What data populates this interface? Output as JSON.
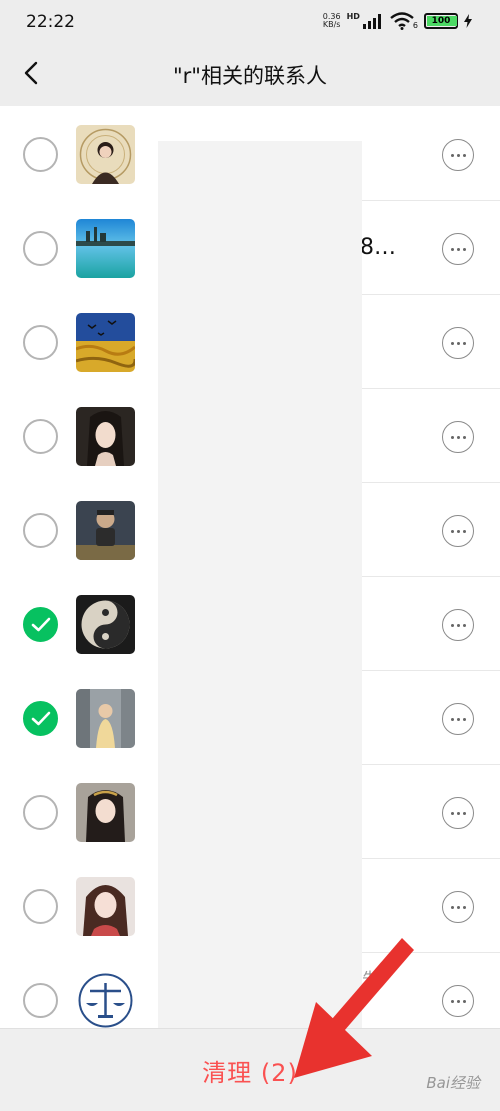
{
  "status_bar": {
    "time": "22:22",
    "net_speed_value": "0.36",
    "net_speed_unit": "KB/s",
    "hd_label": "HD",
    "wifi_badge": "6",
    "battery": "100",
    "battery_level": 1.0
  },
  "nav": {
    "title": "\"r\"相关的联系人",
    "back_icon": "chevron-left-icon"
  },
  "contacts": [
    {
      "selected": false,
      "avatar": "vintage-portrait",
      "name": "",
      "note": ""
    },
    {
      "selected": false,
      "avatar": "lake-castle",
      "name": "8…",
      "note": ""
    },
    {
      "selected": false,
      "avatar": "wheat-field-crows",
      "name": "",
      "note": ""
    },
    {
      "selected": false,
      "avatar": "woman-portrait",
      "name": "",
      "note": ""
    },
    {
      "selected": false,
      "avatar": "cartoon-figure",
      "name": "",
      "note": ""
    },
    {
      "selected": true,
      "avatar": "yin-yang",
      "name": "",
      "note": ""
    },
    {
      "selected": true,
      "avatar": "street-girl",
      "name": "",
      "note": ""
    },
    {
      "selected": false,
      "avatar": "woman-headdress",
      "name": "",
      "note": ""
    },
    {
      "selected": false,
      "avatar": "anime-girl",
      "name": "",
      "note": ""
    },
    {
      "selected": false,
      "avatar": "scales-emblem",
      "name": "",
      "note": "朱"
    }
  ],
  "bottom": {
    "clean_label": "清理 (2)"
  },
  "watermark": "Bai经验",
  "colors": {
    "accent_green": "#07c160",
    "danger_red": "#fa5151",
    "annotation_red": "#e8322e",
    "header_gray": "#ededed"
  }
}
